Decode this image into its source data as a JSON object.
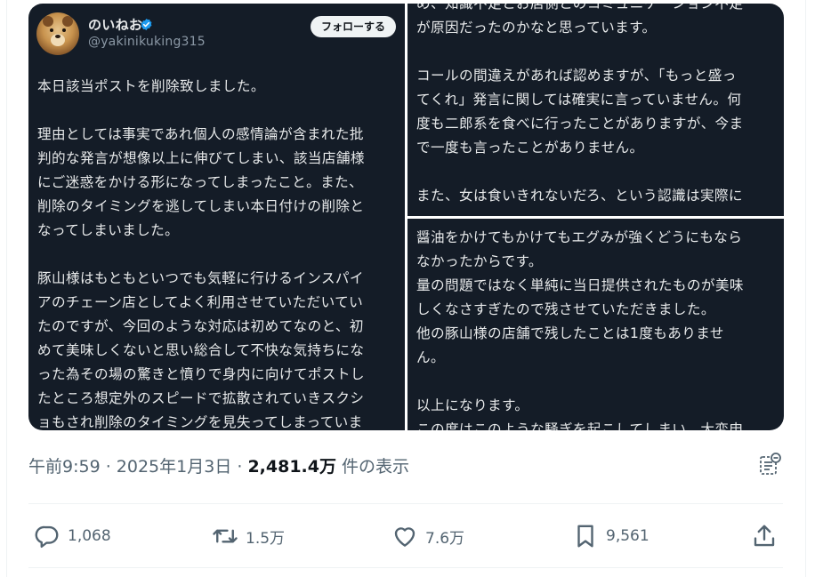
{
  "profile": {
    "display_name": "のいねお",
    "handle": "@yakinikuking315",
    "follow_label": "フォローする"
  },
  "panes": {
    "left": "本日該当ポストを削除致しました。\n\n理由としては事実であれ個人の感情論が含まれた批\n判的な発言が想像以上に伸びてしまい、該当店舗様\nにご迷惑をかける形になってしまったこと。また、\n削除のタイミングを逃してしまい本日付けの削除と\nなってしまいました。\n\n豚山様はもともといつでも気軽に行けるインスパイ\nアのチェーン店としてよく利用させていただいてい\nたのですが、今回のような対応は初めてなのと、初\nめて美味しくないと思い総合して不快な気持ちにな\nった為その場の驚きと憤りで身内に向けてポストし\nたところ想定外のスピードで拡散されていきスクシ\nョもされ削除のタイミングを見失ってしまっていま",
    "top_right": "め、知識不足とお店側とのコミュニケーション不足\nが原因だったのかなと思っています。\n\nコールの間違えがあれば認めますが、「もっと盛っ\nてくれ」発言に関しては確実に言っていません。何\n度も二郎系を食べに行ったことがありますが、今ま\nで一度も言ったことがありません。\n\nまた、女は食いきれないだろ、という認識は実際に",
    "bottom_right": "醤油をかけてもかけてもエグみが強くどうにもなら\nなかったからです。\n量の問題ではなく単純に当日提供されたものが美味\nしくなさすぎたので残させていただきました。\n他の豚山様の店舗で残したことは1度もありませ\nん。\n\n以上になります。\nこの度はこのような騒ぎを起こしてしまい、大変申"
  },
  "meta": {
    "time_date": "午前9:59 · 2025年1月3日 · ",
    "views_count": "2,481.4万",
    "views_label": " 件の表示"
  },
  "actions": {
    "replies": "1,068",
    "reposts": "1.5万",
    "likes": "7.6万",
    "bookmarks": "9,561"
  },
  "colors": {
    "pane_background": "#141c27",
    "pane_text": "#e7e9ea",
    "meta_gray": "#536471",
    "verified_blue": "#1d9bf0"
  },
  "icons": [
    "verified-badge-icon",
    "analytics-icon",
    "reply-icon",
    "repost-icon",
    "like-icon",
    "bookmark-icon",
    "share-icon"
  ]
}
